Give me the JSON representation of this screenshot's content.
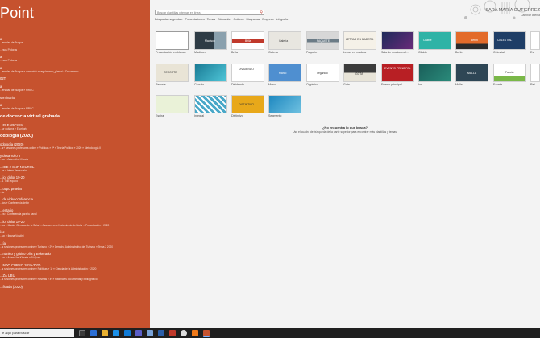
{
  "app": {
    "title": "Point"
  },
  "recent": [
    {
      "name": "a",
      "path": "...ersidad de Burgos"
    },
    {
      "name": "",
      "path": "...rsos Pildoras"
    },
    {
      "name": "a",
      "path": "...rsos Pildoras"
    },
    {
      "name": "a",
      "path": "...ersidad de Burgos » comunicó » seguimiento_plan ai » Documento"
    },
    {
      "name": "02T",
      "path": ""
    },
    {
      "name": "a",
      "path": "...ersidad de Burgos » MRCC"
    },
    {
      "name": "seminario",
      "path": ""
    },
    {
      "name": "a",
      "path": "...ersidad de Burgos » MRCC"
    },
    {
      "name": "de docencia virtual grabada",
      "path": "",
      "big": true
    },
    {
      "name": "...ELEARCS19",
      "path": "...ur guitarra » Escritorio"
    },
    {
      "name": "odología (2020)",
      "path": "",
      "big": true
    },
    {
      "name": "odología (2020)",
      "path": "...s+ sesiones profesores online » Políticas » 2ª » Teoría Política » 2020 » Metodología II"
    },
    {
      "name": "y desarrollo II",
      "path": "...ux » Adam Ure Khweia"
    },
    {
      "name": "...ICE 2 SNP NEUROL",
      "path": "...rs » Intern Venezuela"
    },
    {
      "name": "...ior dolor 19-20",
      "path": "...1 TNE equipo"
    },
    {
      "name": "...otipo prueba",
      "path": "...ia"
    },
    {
      "name": "...de videoconferencia",
      "path": "...los » Conferencia delfín"
    },
    {
      "name": "...entario",
      "path": "...ra » Conferencia para tu canal"
    },
    {
      "name": "...ior dolor 19-20",
      "path": "...os » Master Ciencias de la Salud » Avances en el tratamiento del dolor » Presentación » 2020"
    },
    {
      "name": "ías",
      "path": "...ux » Ileana Vosdini"
    },
    {
      "name": "...ía",
      "path": "...s sesiones profesores online » Turismo » 2ª » Derecho Administrativo del Turismo » Tema 2 2020"
    },
    {
      "name": "...nánico y gótico Oña y Bekerado",
      "path": "...ux » Adam Ure Khweia » 1ª Quan"
    },
    {
      "name": "...NDO CURSO 2019-2020",
      "path": "...s sesiones profesores online » Políticas » 1ª » Ciencia de la Administración » 2020"
    },
    {
      "name": "...ZA UBU",
      "path": "...s sesiones profesores online » Novelas » 4ª » Materiales documental y bibliográfico"
    },
    {
      "name": "...ficada (2020)",
      "path": ""
    }
  ],
  "search": {
    "placeholder": "Buscar plantillas y temas en línea",
    "icon": "search-icon"
  },
  "tags": [
    "Búsquedas sugeridas:",
    "Presentaciones",
    "Temas",
    "Educación",
    "Gráficos",
    "Diagramas",
    "Empresa",
    "Infografía"
  ],
  "user": {
    "name": "SARA MARÍA GUTIERREZ",
    "sub": "Cambiar cuenta"
  },
  "templates": [
    {
      "label": "Presentación en blanco",
      "title": ""
    },
    {
      "label": "Madison",
      "title": "Madison"
    },
    {
      "label": "Brilla",
      "title": "Brilla"
    },
    {
      "label": "Galería",
      "title": "Galería"
    },
    {
      "label": "Paquete",
      "title": "PAQUETE"
    },
    {
      "label": "Letras en madera",
      "title": "LETRAS EN MADERA"
    },
    {
      "label": "Sala de reuniones I...",
      "title": ""
    },
    {
      "label": "Citable",
      "title": "Citable"
    },
    {
      "label": "Berlín",
      "title": "Berlín"
    },
    {
      "label": "Celestial",
      "title": "CELESTIAL"
    },
    {
      "label": "Ev",
      "title": ""
    },
    {
      "label": "Recorte",
      "title": "RECORTE"
    },
    {
      "label": "Circuito",
      "title": ""
    },
    {
      "label": "Dividendo",
      "title": "DIVIDENDO"
    },
    {
      "label": "Marco",
      "title": "Marco"
    },
    {
      "label": "Orgánico",
      "title": "Orgánico"
    },
    {
      "label": "Gota",
      "title": "GOTA"
    },
    {
      "label": "Evento principal",
      "title": "EVENTO PRINCIPAL"
    },
    {
      "label": "Ion",
      "title": ""
    },
    {
      "label": "Malla",
      "title": "MALLA"
    },
    {
      "label": "Faceta",
      "title": "Faceta"
    },
    {
      "label": "Ret",
      "title": ""
    },
    {
      "label": "Espiral",
      "title": ""
    },
    {
      "label": "Integral",
      "title": ""
    },
    {
      "label": "Distintivo",
      "title": "DISTINTIVO"
    },
    {
      "label": "Segmento",
      "title": ""
    }
  ],
  "not_found": {
    "title": "¿No encuentra lo que busca?",
    "body": "Use el cuadro de búsqueda de la parte superior para encontrar más plantillas y temas."
  },
  "taskbar": {
    "search_text": "e aquí para buscar"
  }
}
